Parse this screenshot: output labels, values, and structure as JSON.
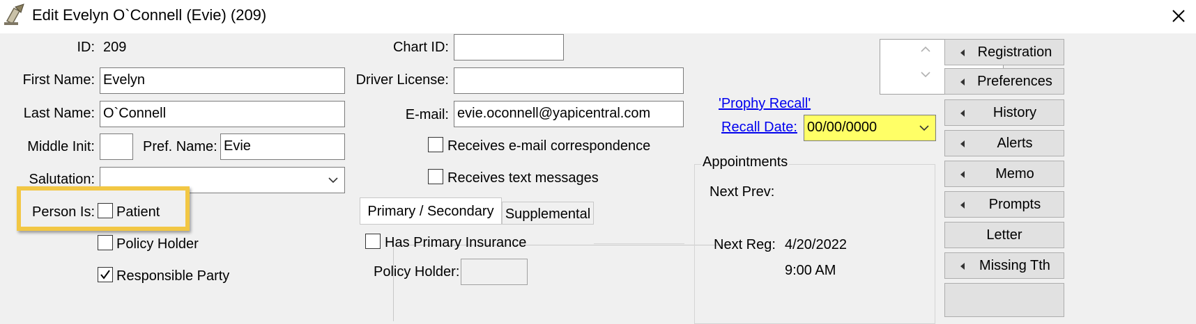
{
  "window": {
    "title": "Edit Evelyn O`Connell (Evie) (209)"
  },
  "left_form": {
    "id_label": "ID:",
    "id_value": "209",
    "first_name_label": "First Name:",
    "first_name_value": "Evelyn",
    "last_name_label": "Last Name:",
    "last_name_value": "O`Connell",
    "middle_init_label": "Middle Init:",
    "middle_init_value": "",
    "pref_name_label": "Pref. Name:",
    "pref_name_value": "Evie",
    "salutation_label": "Salutation:",
    "salutation_value": "",
    "person_is_label": "Person Is:",
    "patient_label": "Patient",
    "patient_checked": false,
    "policy_holder_label": "Policy Holder",
    "policy_holder_checked": false,
    "responsible_party_label": "Responsible Party",
    "responsible_party_checked": true
  },
  "middle_form": {
    "chart_id_label": "Chart ID:",
    "chart_id_value": "",
    "driver_license_label": "Driver License:",
    "driver_license_value": "",
    "email_label": "E-mail:",
    "email_value": "evie.oconnell@yapicentral.com",
    "receives_email_label": "Receives e-mail correspondence",
    "receives_email_checked": false,
    "receives_text_label": "Receives text messages",
    "receives_text_checked": false
  },
  "insurance_tabs": {
    "tabs": [
      "Primary / Secondary",
      "Supplemental"
    ],
    "active": "Primary / Secondary",
    "has_primary_label": "Has Primary Insurance",
    "has_primary_checked": false,
    "policy_holder_label": "Policy Holder:",
    "policy_holder_value": ""
  },
  "recall": {
    "recall_type_link": "'Prophy Recall'",
    "recall_date_link": "Recall Date:",
    "recall_date_value": "00/00/0000",
    "highlight_color": "#ffff66"
  },
  "appointments": {
    "group_title": "Appointments",
    "next_prev_label": "Next Prev:",
    "next_prev_value": "",
    "next_reg_label": "Next Reg:",
    "next_reg_date": "4/20/2022",
    "next_reg_time": "9:00 AM"
  },
  "side_buttons": [
    {
      "label": "Registration",
      "arrow": true
    },
    {
      "label": "Preferences",
      "arrow": true
    },
    {
      "label": "History",
      "arrow": true
    },
    {
      "label": "Alerts",
      "arrow": true
    },
    {
      "label": "Memo",
      "arrow": true
    },
    {
      "label": "Prompts",
      "arrow": true
    },
    {
      "label": "Letter",
      "arrow": false
    },
    {
      "label": "Missing Tth",
      "arrow": true
    }
  ],
  "colors": {
    "callout_border": "#f2c744",
    "link": "#0000ee"
  }
}
